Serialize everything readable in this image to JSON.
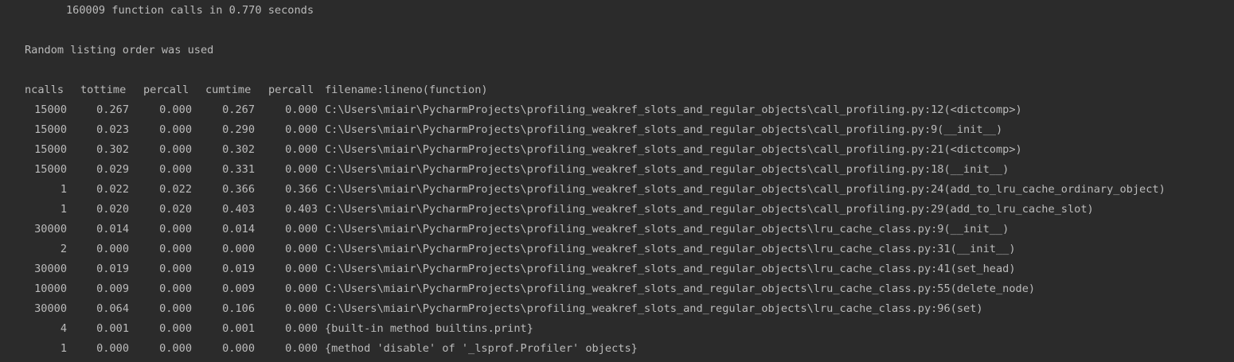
{
  "output": {
    "summary": "160009 function calls in 0.770 seconds",
    "order_note": "Random listing order was used"
  },
  "table": {
    "headers": {
      "ncalls": "ncalls",
      "tottime": "tottime",
      "percall1": "percall",
      "cumtime": "cumtime",
      "percall2": "percall",
      "filename": "filename:lineno(function)"
    },
    "rows": [
      {
        "ncalls": "15000",
        "tottime": "0.267",
        "percall1": "0.000",
        "cumtime": "0.267",
        "percall2": "0.000",
        "filename": "C:\\Users\\miair\\PycharmProjects\\profiling_weakref_slots_and_regular_objects\\call_profiling.py:12(<dictcomp>)"
      },
      {
        "ncalls": "15000",
        "tottime": "0.023",
        "percall1": "0.000",
        "cumtime": "0.290",
        "percall2": "0.000",
        "filename": "C:\\Users\\miair\\PycharmProjects\\profiling_weakref_slots_and_regular_objects\\call_profiling.py:9(__init__)"
      },
      {
        "ncalls": "15000",
        "tottime": "0.302",
        "percall1": "0.000",
        "cumtime": "0.302",
        "percall2": "0.000",
        "filename": "C:\\Users\\miair\\PycharmProjects\\profiling_weakref_slots_and_regular_objects\\call_profiling.py:21(<dictcomp>)"
      },
      {
        "ncalls": "15000",
        "tottime": "0.029",
        "percall1": "0.000",
        "cumtime": "0.331",
        "percall2": "0.000",
        "filename": "C:\\Users\\miair\\PycharmProjects\\profiling_weakref_slots_and_regular_objects\\call_profiling.py:18(__init__)"
      },
      {
        "ncalls": "1",
        "tottime": "0.022",
        "percall1": "0.022",
        "cumtime": "0.366",
        "percall2": "0.366",
        "filename": "C:\\Users\\miair\\PycharmProjects\\profiling_weakref_slots_and_regular_objects\\call_profiling.py:24(add_to_lru_cache_ordinary_object)"
      },
      {
        "ncalls": "1",
        "tottime": "0.020",
        "percall1": "0.020",
        "cumtime": "0.403",
        "percall2": "0.403",
        "filename": "C:\\Users\\miair\\PycharmProjects\\profiling_weakref_slots_and_regular_objects\\call_profiling.py:29(add_to_lru_cache_slot)"
      },
      {
        "ncalls": "30000",
        "tottime": "0.014",
        "percall1": "0.000",
        "cumtime": "0.014",
        "percall2": "0.000",
        "filename": "C:\\Users\\miair\\PycharmProjects\\profiling_weakref_slots_and_regular_objects\\lru_cache_class.py:9(__init__)"
      },
      {
        "ncalls": "2",
        "tottime": "0.000",
        "percall1": "0.000",
        "cumtime": "0.000",
        "percall2": "0.000",
        "filename": "C:\\Users\\miair\\PycharmProjects\\profiling_weakref_slots_and_regular_objects\\lru_cache_class.py:31(__init__)"
      },
      {
        "ncalls": "30000",
        "tottime": "0.019",
        "percall1": "0.000",
        "cumtime": "0.019",
        "percall2": "0.000",
        "filename": "C:\\Users\\miair\\PycharmProjects\\profiling_weakref_slots_and_regular_objects\\lru_cache_class.py:41(set_head)"
      },
      {
        "ncalls": "10000",
        "tottime": "0.009",
        "percall1": "0.000",
        "cumtime": "0.009",
        "percall2": "0.000",
        "filename": "C:\\Users\\miair\\PycharmProjects\\profiling_weakref_slots_and_regular_objects\\lru_cache_class.py:55(delete_node)"
      },
      {
        "ncalls": "30000",
        "tottime": "0.064",
        "percall1": "0.000",
        "cumtime": "0.106",
        "percall2": "0.000",
        "filename": "C:\\Users\\miair\\PycharmProjects\\profiling_weakref_slots_and_regular_objects\\lru_cache_class.py:96(set)"
      },
      {
        "ncalls": "4",
        "tottime": "0.001",
        "percall1": "0.000",
        "cumtime": "0.001",
        "percall2": "0.000",
        "filename": "{built-in method builtins.print}"
      },
      {
        "ncalls": "1",
        "tottime": "0.000",
        "percall1": "0.000",
        "cumtime": "0.000",
        "percall2": "0.000",
        "filename": "{method 'disable' of '_lsprof.Profiler' objects}"
      }
    ]
  },
  "colors": {
    "background": "#2b2b2b",
    "text": "#bbbbbb"
  }
}
